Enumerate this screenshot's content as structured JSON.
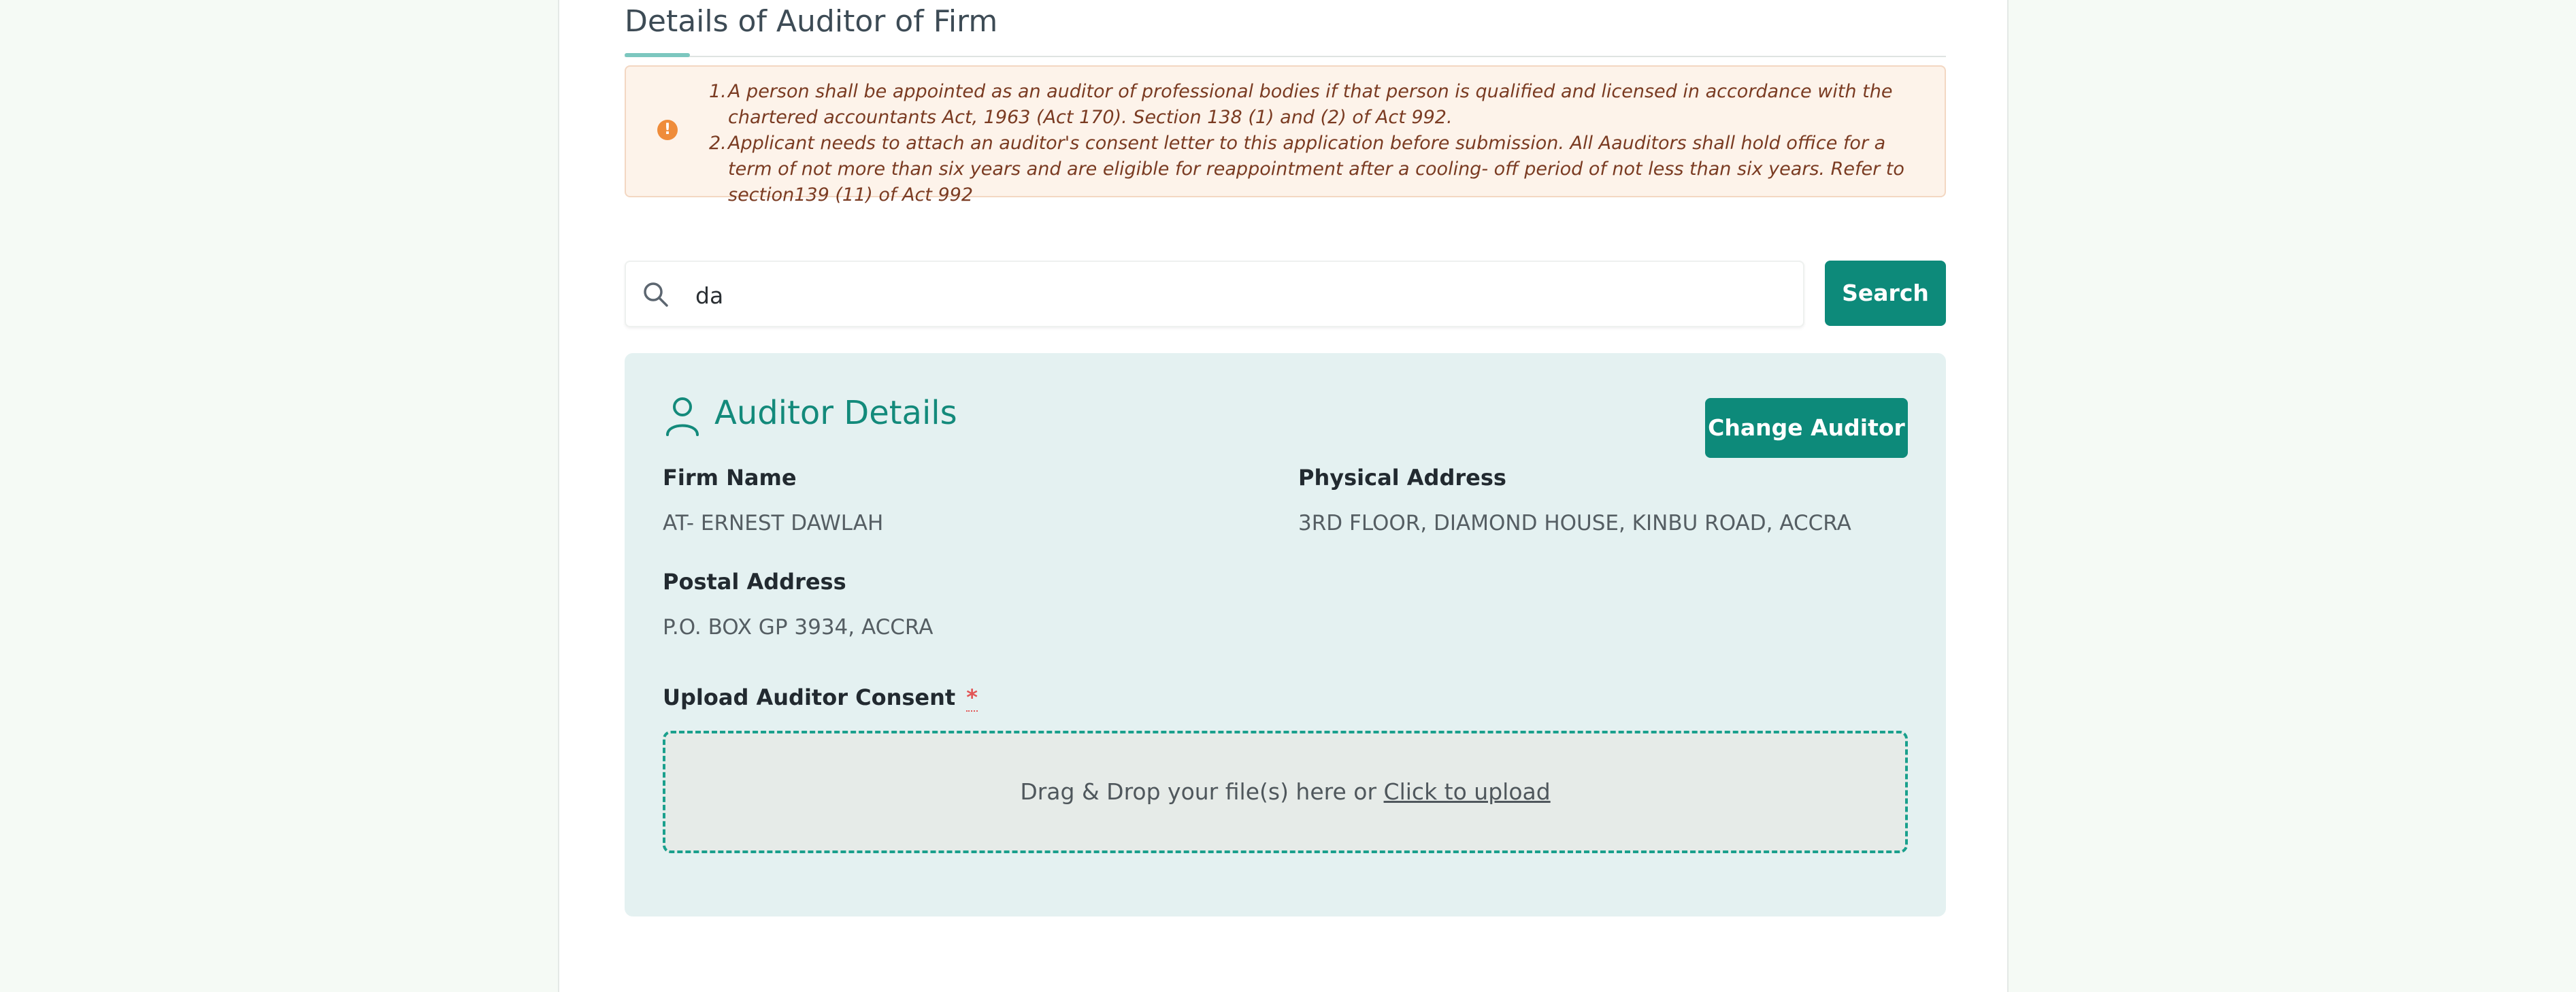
{
  "section": {
    "title": "Details of Auditor of Firm"
  },
  "notice": {
    "icon": "warning-circle-icon",
    "items": [
      {
        "number": "1.",
        "text": "A person shall be appointed as an auditor of professional bodies if that person is qualified and licensed in accordance with the chartered accountants Act, 1963 (Act 170). Section 138 (1) and (2) of Act 992."
      },
      {
        "number": "2.",
        "text": "Applicant needs to attach an auditor's consent letter to this application before submission. All Aauditors shall hold office for a term of not more than six years and are eligible for reappointment after a cooling- off period of not less than six years. Refer to section139 (11) of Act 992"
      }
    ]
  },
  "search": {
    "value": "da",
    "button_label": "Search"
  },
  "auditor": {
    "title": "Auditor Details",
    "change_button_label": "Change Auditor",
    "fields": {
      "firm_name_label": "Firm Name",
      "firm_name_value": "AT- ERNEST DAWLAH",
      "physical_address_label": "Physical Address",
      "physical_address_value": "3RD FLOOR, DIAMOND HOUSE, KINBU ROAD, ACCRA",
      "postal_address_label": "Postal Address",
      "postal_address_value": "P.O. BOX GP 3934, ACCRA"
    },
    "upload": {
      "label": "Upload Auditor Consent",
      "required_mark": "*",
      "drop_text": "Drag & Drop your file(s) here or",
      "link_text": "Click to upload"
    }
  },
  "colors": {
    "accent": "#0d8a7a",
    "card_bg": "#e4f1f1",
    "notice_bg": "#fdf3ea",
    "notice_text": "#7a3b22",
    "warning": "#ef8c3a"
  }
}
